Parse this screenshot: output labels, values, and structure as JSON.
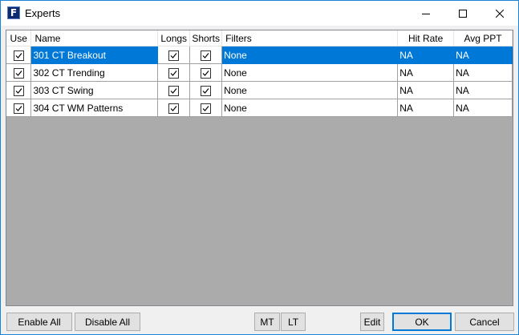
{
  "window": {
    "title": "Experts",
    "icon": "F"
  },
  "grid": {
    "columns": {
      "use": "Use",
      "name": "Name",
      "longs": "Longs",
      "shorts": "Shorts",
      "filters": "Filters",
      "hit_rate": "Hit Rate",
      "avg_ppt": "Avg PPT"
    },
    "rows": [
      {
        "use": true,
        "name": "301 CT Breakout",
        "longs": true,
        "shorts": true,
        "filters": "None",
        "hit_rate": "NA",
        "avg_ppt": "NA",
        "selected": true
      },
      {
        "use": true,
        "name": "302 CT Trending",
        "longs": true,
        "shorts": true,
        "filters": "None",
        "hit_rate": "NA",
        "avg_ppt": "NA",
        "selected": false
      },
      {
        "use": true,
        "name": "303 CT Swing",
        "longs": true,
        "shorts": true,
        "filters": "None",
        "hit_rate": "NA",
        "avg_ppt": "NA",
        "selected": false
      },
      {
        "use": true,
        "name": "304 CT WM Patterns",
        "longs": true,
        "shorts": true,
        "filters": "None",
        "hit_rate": "NA",
        "avg_ppt": "NA",
        "selected": false
      }
    ]
  },
  "buttons": {
    "enable_all": "Enable All",
    "disable_all": "Disable All",
    "mt": "MT",
    "lt": "LT",
    "edit": "Edit",
    "ok": "OK",
    "cancel": "Cancel"
  },
  "colors": {
    "selection": "#0078d7",
    "empty_area": "#ababab",
    "window_border": "#1883d7"
  }
}
